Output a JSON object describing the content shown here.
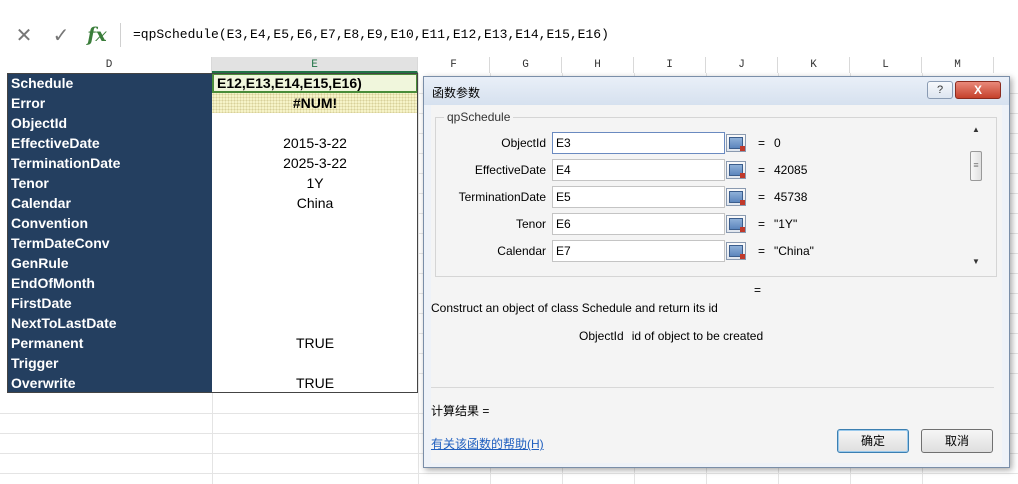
{
  "formula_bar": {
    "cancel_icon": "✕",
    "enter_icon": "✓",
    "fx_label": "fx",
    "formula": "=qpSchedule(E3,E4,E5,E6,E7,E8,E9,E10,E11,E12,E13,E14,E15,E16)"
  },
  "columns": [
    "D",
    "E",
    "F",
    "G",
    "H",
    "I",
    "J",
    "K",
    "L",
    "M"
  ],
  "rows": [
    {
      "label": "Schedule",
      "value": "E12,E13,E14,E15,E16)"
    },
    {
      "label": "Error",
      "value": "#NUM!"
    },
    {
      "label": "ObjectId",
      "value": ""
    },
    {
      "label": "EffectiveDate",
      "value": "2015-3-22"
    },
    {
      "label": "TerminationDate",
      "value": "2025-3-22"
    },
    {
      "label": "Tenor",
      "value": "1Y"
    },
    {
      "label": "Calendar",
      "value": "China"
    },
    {
      "label": "Convention",
      "value": ""
    },
    {
      "label": "TermDateConv",
      "value": ""
    },
    {
      "label": "GenRule",
      "value": ""
    },
    {
      "label": "EndOfMonth",
      "value": ""
    },
    {
      "label": "FirstDate",
      "value": ""
    },
    {
      "label": "NextToLastDate",
      "value": ""
    },
    {
      "label": "Permanent",
      "value": "TRUE"
    },
    {
      "label": "Trigger",
      "value": ""
    },
    {
      "label": "Overwrite",
      "value": "TRUE"
    }
  ],
  "dialog": {
    "title": "函数参数",
    "help_btn": "?",
    "close_btn": "X",
    "function_name": "qpSchedule",
    "params": [
      {
        "name": "ObjectId",
        "ref": "E3",
        "value": "0"
      },
      {
        "name": "EffectiveDate",
        "ref": "E4",
        "value": "42085"
      },
      {
        "name": "TerminationDate",
        "ref": "E5",
        "value": "45738"
      },
      {
        "name": "Tenor",
        "ref": "E6",
        "value": "\"1Y\""
      },
      {
        "name": "Calendar",
        "ref": "E7",
        "value": "\"China\""
      }
    ],
    "equals": "=",
    "result_equals": "=",
    "description": "Construct an object of class Schedule and return its id",
    "arg_name": "ObjectId",
    "arg_description": "id of object to be created",
    "calc_result": "计算结果 =",
    "help_link": "有关该函数的帮助(H)",
    "ok_label": "确定",
    "cancel_label": "取消"
  }
}
